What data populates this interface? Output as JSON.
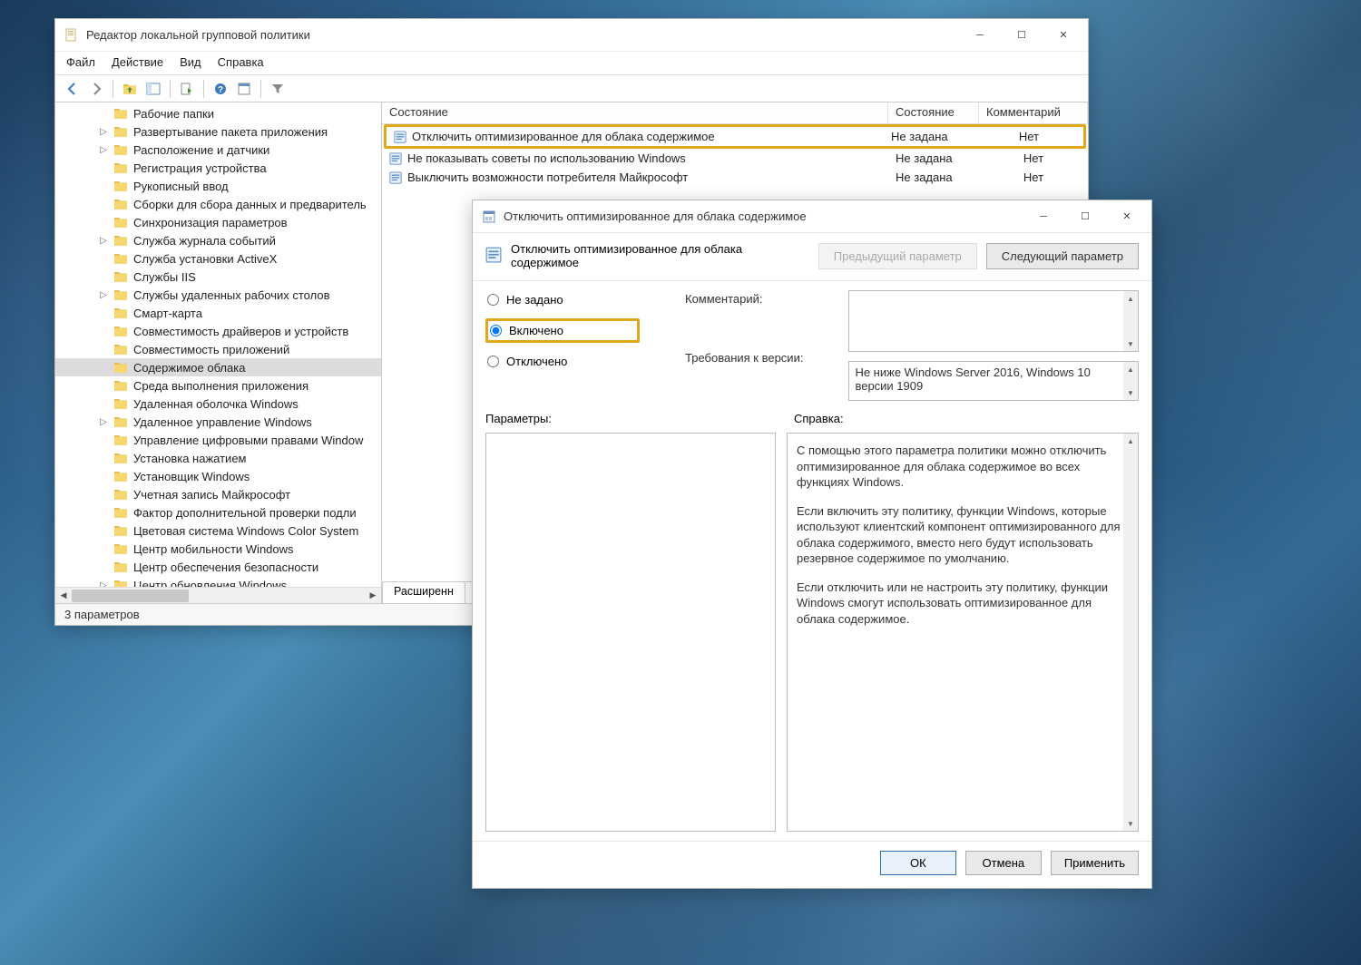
{
  "gpo_window": {
    "title": "Редактор локальной групповой политики",
    "menu": {
      "file": "Файл",
      "action": "Действие",
      "view": "Вид",
      "help": "Справка"
    },
    "status": "3 параметров",
    "list": {
      "headers": {
        "a": "Состояние",
        "b": "Состояние",
        "c": "Комментарий"
      },
      "rows": [
        {
          "label": "Отключить оптимизированное для облака содержимое",
          "state": "Не задана",
          "comment": "Нет",
          "highlighted": true
        },
        {
          "label": "Не показывать советы по использованию Windows",
          "state": "Не задана",
          "comment": "Нет",
          "highlighted": false
        },
        {
          "label": "Выключить возможности потребителя Майкрософт",
          "state": "Не задана",
          "comment": "Нет",
          "highlighted": false
        }
      ]
    },
    "tab_extended": "Расширенн",
    "tree": [
      {
        "label": "Рабочие папки",
        "expander": ""
      },
      {
        "label": "Развертывание пакета приложения",
        "expander": "▷"
      },
      {
        "label": "Расположение и датчики",
        "expander": "▷"
      },
      {
        "label": "Регистрация устройства",
        "expander": ""
      },
      {
        "label": "Рукописный ввод",
        "expander": ""
      },
      {
        "label": "Сборки для сбора данных и предваритель",
        "expander": ""
      },
      {
        "label": "Синхронизация параметров",
        "expander": ""
      },
      {
        "label": "Служба журнала событий",
        "expander": "▷"
      },
      {
        "label": "Служба установки ActiveX",
        "expander": ""
      },
      {
        "label": "Службы IIS",
        "expander": ""
      },
      {
        "label": "Службы удаленных рабочих столов",
        "expander": "▷"
      },
      {
        "label": "Смарт-карта",
        "expander": ""
      },
      {
        "label": "Совместимость драйверов и устройств",
        "expander": ""
      },
      {
        "label": "Совместимость приложений",
        "expander": ""
      },
      {
        "label": "Содержимое облака",
        "expander": "",
        "selected": true
      },
      {
        "label": "Среда выполнения приложения",
        "expander": ""
      },
      {
        "label": "Удаленная оболочка Windows",
        "expander": ""
      },
      {
        "label": "Удаленное управление Windows",
        "expander": "▷"
      },
      {
        "label": "Управление цифровыми правами Window",
        "expander": ""
      },
      {
        "label": "Установка нажатием",
        "expander": ""
      },
      {
        "label": "Установщик Windows",
        "expander": ""
      },
      {
        "label": "Учетная запись Майкрософт",
        "expander": ""
      },
      {
        "label": "Фактор дополнительной проверки подли",
        "expander": ""
      },
      {
        "label": "Цветовая система Windows Color System",
        "expander": ""
      },
      {
        "label": "Центр мобильности Windows",
        "expander": ""
      },
      {
        "label": "Центр обеспечения безопасности",
        "expander": ""
      },
      {
        "label": "Центр обновления Windows",
        "expander": "▷"
      }
    ]
  },
  "dialog": {
    "title": "Отключить оптимизированное для облака содержимое",
    "policy_name": "Отключить оптимизированное для облака содержимое",
    "prev_btn": "Предыдущий параметр",
    "next_btn": "Следующий параметр",
    "radio": {
      "not_configured": "Не задано",
      "enabled": "Включено",
      "disabled": "Отключено"
    },
    "comment_label": "Комментарий:",
    "version_label": "Требования к версии:",
    "version_value": "Не ниже Windows Server 2016, Windows 10 версии 1909",
    "params_label": "Параметры:",
    "help_label": "Справка:",
    "help_p1": "С помощью этого параметра политики можно отключить оптимизированное для облака содержимое во всех функциях Windows.",
    "help_p2": "Если включить эту политику, функции Windows, которые используют клиентский компонент оптимизированного для облака содержимого, вместо него будут использовать резервное содержимое по умолчанию.",
    "help_p3": "Если отключить или не настроить эту политику, функции Windows смогут использовать оптимизированное для облака содержимое.",
    "ok": "ОК",
    "cancel": "Отмена",
    "apply": "Применить"
  }
}
